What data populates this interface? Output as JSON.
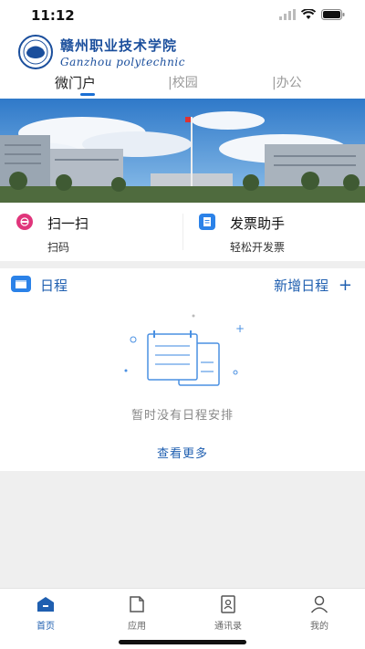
{
  "status": {
    "time": "11:12"
  },
  "header": {
    "school_name": "赣州职业技术学院",
    "school_name_en": "Ganzhou polytechnic"
  },
  "tabs": [
    {
      "label": "微门户",
      "active": true
    },
    {
      "label": "|校园",
      "active": false
    },
    {
      "label": "|办公",
      "active": false
    }
  ],
  "quick_actions": [
    {
      "title": "扫一扫",
      "subtitle": "扫码",
      "icon": "scan-icon",
      "color": "#e0357b"
    },
    {
      "title": "发票助手",
      "subtitle": "轻松开发票",
      "icon": "invoice-icon",
      "color": "#2b82e8"
    }
  ],
  "schedule": {
    "title": "日程",
    "add_label": "新增日程",
    "empty_text": "暂时没有日程安排",
    "more_label": "查看更多"
  },
  "bottom_nav": [
    {
      "label": "首页",
      "icon": "home-icon",
      "active": true
    },
    {
      "label": "应用",
      "icon": "apps-icon",
      "active": false
    },
    {
      "label": "通讯录",
      "icon": "contacts-icon",
      "active": false
    },
    {
      "label": "我的",
      "icon": "profile-icon",
      "active": false
    }
  ],
  "colors": {
    "accent": "#1f5fb0",
    "scan": "#e0357b",
    "invoice": "#2b82e8"
  }
}
